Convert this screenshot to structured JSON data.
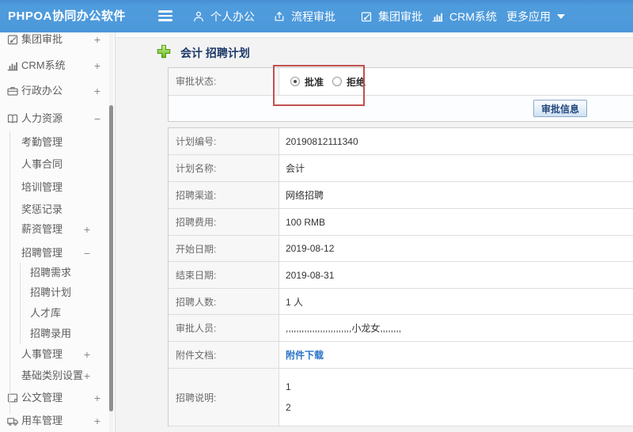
{
  "navbar": {
    "logo": "PHPOA协同办公软件",
    "items": [
      {
        "name": "personal-office",
        "icon": "user-icon",
        "label": "个人办公"
      },
      {
        "name": "flow-approval",
        "icon": "flow-icon",
        "label": "流程审批"
      },
      {
        "name": "group-approval",
        "icon": "edit-icon",
        "label": "集团审批"
      },
      {
        "name": "crm-system",
        "icon": "chart-icon",
        "label": "CRM系统"
      },
      {
        "name": "more-apps",
        "icon": "caret-down-icon",
        "label": "更多应用",
        "caret": true
      }
    ]
  },
  "sidebar": {
    "items": [
      {
        "name": "group-approval",
        "label": "集团审批",
        "level": 0,
        "icon": "edit-icon",
        "marker": "+"
      },
      {
        "name": "crm-system",
        "label": "CRM系统",
        "level": 0,
        "icon": "chart-icon",
        "marker": "+"
      },
      {
        "name": "admin-office",
        "label": "行政办公",
        "level": 0,
        "icon": "briefcase-icon",
        "marker": "+"
      },
      {
        "name": "human-resources",
        "label": "人力资源",
        "level": 0,
        "icon": "book-icon",
        "marker": "-"
      },
      {
        "name": "attendance-mgmt",
        "label": "考勤管理",
        "level": 1,
        "marker": ""
      },
      {
        "name": "hr-contract",
        "label": "人事合同",
        "level": 1,
        "marker": ""
      },
      {
        "name": "training-mgmt",
        "label": "培训管理",
        "level": 1,
        "marker": ""
      },
      {
        "name": "reward-punish",
        "label": "奖惩记录",
        "level": 1,
        "marker": ""
      },
      {
        "name": "salary-mgmt",
        "label": "薪资管理",
        "level": 1,
        "marker": "+"
      },
      {
        "name": "recruit-mgmt",
        "label": "招聘管理",
        "level": 1,
        "marker": "-"
      },
      {
        "name": "recruit-demand",
        "label": "招聘需求",
        "level": 2,
        "marker": ""
      },
      {
        "name": "recruit-plan",
        "label": "招聘计划",
        "level": 2,
        "marker": ""
      },
      {
        "name": "talent-pool",
        "label": "人才库",
        "level": 2,
        "marker": ""
      },
      {
        "name": "recruit-hire",
        "label": "招聘录用",
        "level": 2,
        "marker": ""
      },
      {
        "name": "personnel-mgmt",
        "label": "人事管理",
        "level": 1,
        "marker": "+"
      },
      {
        "name": "base-category",
        "label": "基础类别设置",
        "level": 1,
        "marker": "+"
      },
      {
        "name": "document-mgmt",
        "label": "公文管理",
        "level": 0,
        "icon": "doc-icon",
        "marker": "+"
      },
      {
        "name": "vehicle-mgmt",
        "label": "用车管理",
        "level": 0,
        "icon": "truck-icon",
        "marker": "+"
      }
    ]
  },
  "main": {
    "title": "会计 招聘计划",
    "approval": {
      "label": "审批状态:",
      "options": [
        {
          "label": "批准",
          "checked": true
        },
        {
          "label": "拒绝",
          "checked": false
        }
      ],
      "button": "审批信息"
    },
    "details": [
      {
        "name": "plan-number",
        "label": "计划编号:",
        "value": "20190812111340"
      },
      {
        "name": "plan-name",
        "label": "计划名称:",
        "value": "会计"
      },
      {
        "name": "recruit-channel",
        "label": "招聘渠道:",
        "value": "网络招聘"
      },
      {
        "name": "recruit-cost",
        "label": "招聘费用:",
        "value": "100 RMB"
      },
      {
        "name": "start-date",
        "label": "开始日期:",
        "value": "2019-08-12"
      },
      {
        "name": "end-date",
        "label": "结束日期:",
        "value": "2019-08-31"
      },
      {
        "name": "headcount",
        "label": "招聘人数:",
        "value": "1 人"
      },
      {
        "name": "approvers",
        "label": "审批人员:",
        "value": ",,,,,,,,,,,,,,,,,,,,,,,,,小龙女,,,,,,,,"
      },
      {
        "name": "attachment",
        "label": "附件文档:",
        "value": "附件下载",
        "type": "link"
      },
      {
        "name": "recruit-note",
        "label": "招聘说明:",
        "lines": [
          "1",
          "2"
        ],
        "type": "lines"
      }
    ]
  },
  "colors": {
    "navbar_blue": "#4c98da",
    "link_blue": "#2a72c8",
    "annotation_red": "#c0504f",
    "title_navy": "#1d3a68",
    "plus_green": "#67b71c"
  }
}
